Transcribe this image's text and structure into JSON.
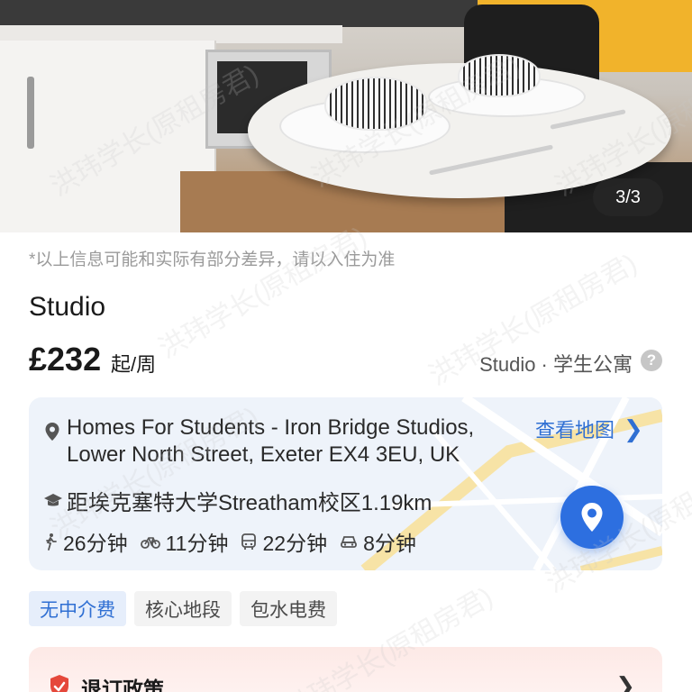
{
  "gallery": {
    "counter": "3/3"
  },
  "disclaimer": "*以上信息可能和实际有部分差异，请以入住为准",
  "room": {
    "title": "Studio",
    "price": "£232",
    "price_unit": "起/周",
    "type_label": "Studio · 学生公寓",
    "help_icon": "?"
  },
  "location": {
    "address": "Homes For Students - Iron Bridge Studios, Lower North Street, Exeter EX4 3EU, UK",
    "view_map_label": "查看地图",
    "university": "距埃克塞特大学Streatham校区1.19km",
    "travel": [
      {
        "icon": "walk-icon",
        "time": "26分钟"
      },
      {
        "icon": "bike-icon",
        "time": "11分钟"
      },
      {
        "icon": "bus-icon",
        "time": "22分钟"
      },
      {
        "icon": "car-icon",
        "time": "8分钟"
      }
    ]
  },
  "tags": [
    "无中介费",
    "核心地段",
    "包水电费"
  ],
  "policy": {
    "title": "退订政策"
  },
  "watermark": "洪玮学长(原租房君)",
  "colors": {
    "accent": "#2f6fd3",
    "map_pin": "#2d6fe0",
    "policy_bg": "#fde9e6",
    "policy_shield": "#e5483b"
  }
}
